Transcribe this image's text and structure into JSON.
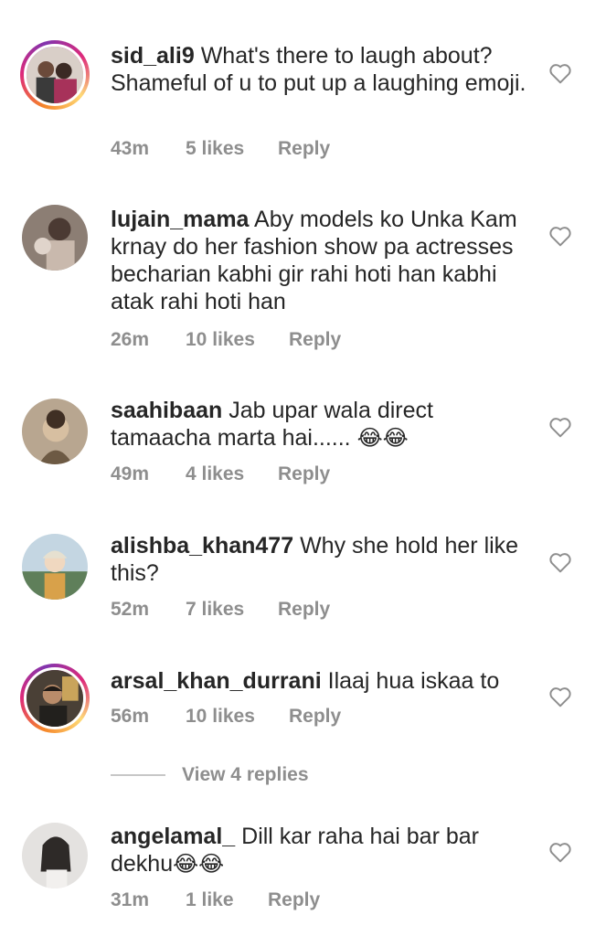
{
  "comments": [
    {
      "username": "sid_ali9",
      "text": "What's there to laugh about? Shameful of u to put up a laughing emoji.",
      "time": "43m",
      "likes": "5 likes",
      "reply": "Reply"
    },
    {
      "username": "lujain_mama",
      "text": "Aby models ko Unka Kam krnay do her fashion show pa actresses becharian kabhi gir rahi hoti han kabhi atak rahi hoti han",
      "time": "26m",
      "likes": "10 likes",
      "reply": "Reply"
    },
    {
      "username": "saahibaan",
      "text": "Jab upar wala direct tamaacha marta hai......",
      "emoji": "😂😂",
      "time": "49m",
      "likes": "4 likes",
      "reply": "Reply"
    },
    {
      "username": "alishba_khan477",
      "text": "Why she hold her like this?",
      "time": "52m",
      "likes": "7 likes",
      "reply": "Reply"
    },
    {
      "username": "arsal_khan_durrani",
      "text": "Ilaaj hua iskaa to",
      "time": "56m",
      "likes": "10 likes",
      "reply": "Reply"
    },
    {
      "username": "angelamal_",
      "text": "Dill kar raha hai bar bar dekhu",
      "emoji": "😂😂",
      "time": "31m",
      "likes": "1 like",
      "reply": "Reply"
    }
  ],
  "view_replies": "View 4 replies",
  "icons": {
    "like": "heart-outline-icon"
  },
  "colors": {
    "text": "#262626",
    "meta": "#8e8e8e",
    "story_ring": "#dd2a7b"
  }
}
